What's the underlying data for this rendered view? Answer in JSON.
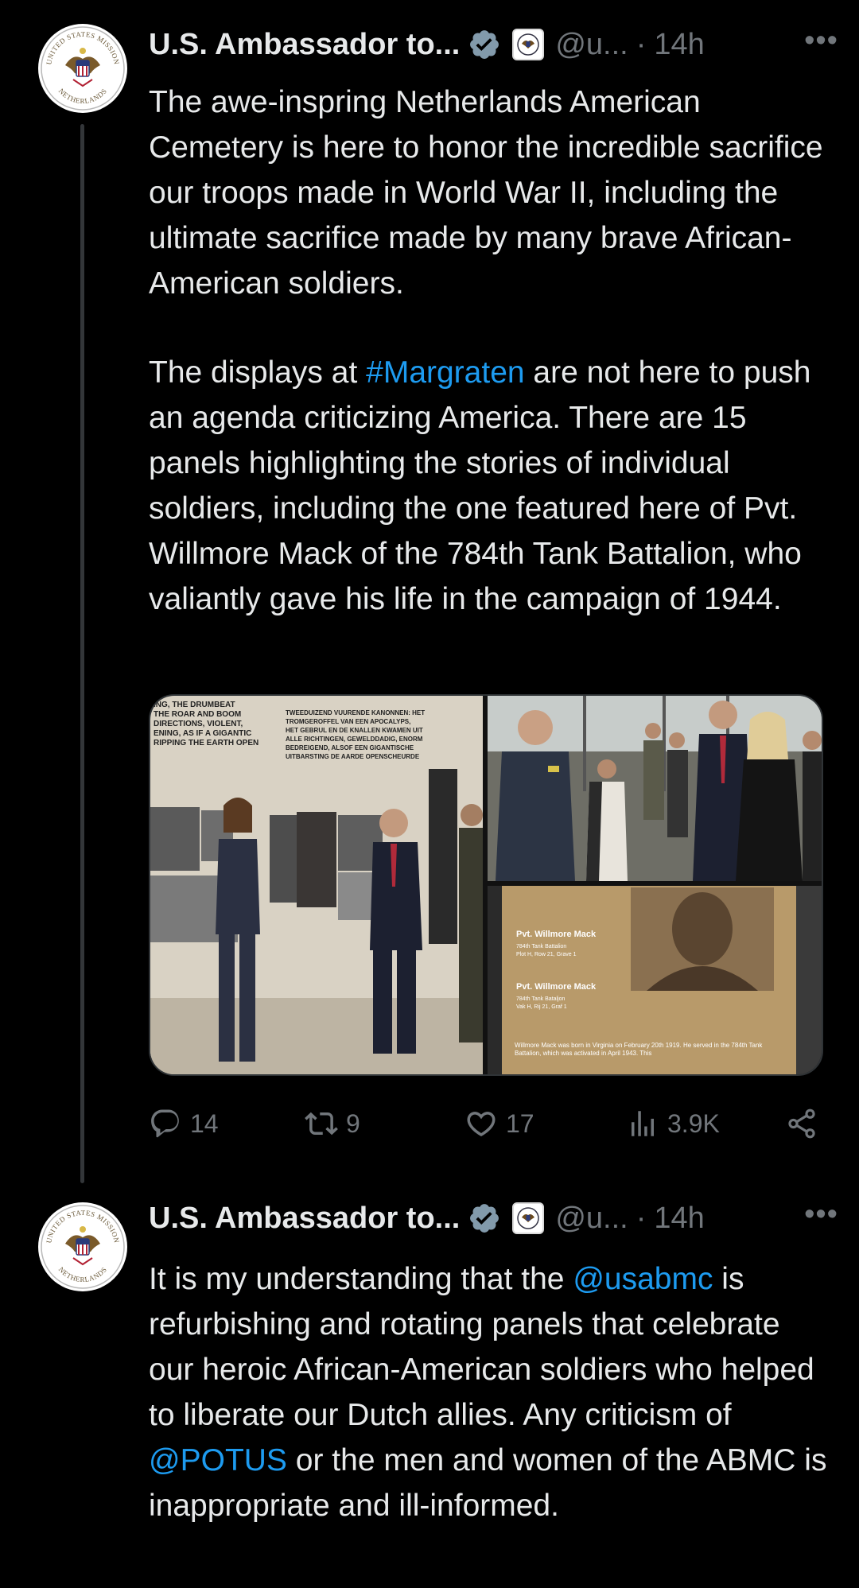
{
  "tweets": [
    {
      "author": {
        "name": "U.S. Ambassador to...",
        "handle": "@u...",
        "time": "14h",
        "avatar_top_text": "UNITED STATES MISSION",
        "avatar_bottom_text": "NETHERLANDS"
      },
      "paragraphs": [
        [
          {
            "text": "The awe-inspring Netherlands American Cemetery is here to honor the incredible sacrifice our troops made in World War II, including the ultimate sacrifice made by many brave African-American soldiers."
          }
        ],
        [
          {
            "text": "The displays at "
          },
          {
            "text": "#Margraten",
            "link": true
          },
          {
            "text": " are not here to push an agenda criticizing America. There are 15 panels highlighting the stories of individual soldiers, including the one featured here of Pvt. Willmore Mack of the 784th Tank Battalion, who valiantly gave his life in the campaign of 1944."
          }
        ]
      ],
      "media": {
        "photo1": {
          "wall_text_en": "...ING, THE DRUMBEAT THE ROAR AND BOOM DIRECTIONS, VIOLENT, ENING, AS IF A GIGANTIC RIPPING THE EARTH OPEN",
          "wall_text_nl": "TWEEDUIZEND VUURENDE KANONNEN: HET TROMGEROFFEL VAN EEN APOCALYPS, HET GEBRUL EN DE KNALLEN KWAMEN UIT ALLE RICHTINGEN, GEWELDDADIG, ENORM BEDREIGEND, ALSOF EEN GIGANTISCHE UITBARSTING DE AARDE OPENSCHEURDE"
        },
        "photo3": {
          "name1": "Pvt. Willmore Mack",
          "sub1a": "784th Tank Battalion",
          "sub1b": "Plot H, Row 21, Grave 1",
          "name2": "Pvt. Willmore Mack",
          "sub2a": "784th Tank Bataljon",
          "sub2b": "Vak H, Rij 21, Graf 1",
          "caption": "Willmore Mack was born in Virginia on February 20th 1919. He served in the 784th Tank Battalion, which was activated in April 1943. This"
        }
      },
      "stats": {
        "replies": "14",
        "retweets": "9",
        "likes": "17",
        "views": "3.9K"
      }
    },
    {
      "author": {
        "name": "U.S. Ambassador to...",
        "handle": "@u...",
        "time": "14h",
        "avatar_top_text": "UNITED STATES MISSION",
        "avatar_bottom_text": "NETHERLANDS"
      },
      "paragraphs": [
        [
          {
            "text": "It is my understanding that the "
          },
          {
            "text": "@usabmc",
            "link": true
          },
          {
            "text": " is refurbishing and rotating panels that celebrate our heroic African-American soldiers who helped to liberate our Dutch allies. Any criticism of "
          },
          {
            "text": "@POTUS",
            "link": true
          },
          {
            "text": " or the men and women of the ABMC is inappropriate and ill-informed."
          }
        ]
      ]
    }
  ],
  "ui": {
    "separator": "·",
    "more_glyph": "•••",
    "icons": [
      "verified-badge-icon",
      "government-seal-icon",
      "reply-icon",
      "retweet-icon",
      "like-icon",
      "views-icon",
      "share-icon",
      "more-options-icon"
    ],
    "colors": {
      "background": "#000000",
      "text": "#e7e9ea",
      "muted": "#71767b",
      "link": "#1d9bf0",
      "verified": "#829aab"
    }
  }
}
